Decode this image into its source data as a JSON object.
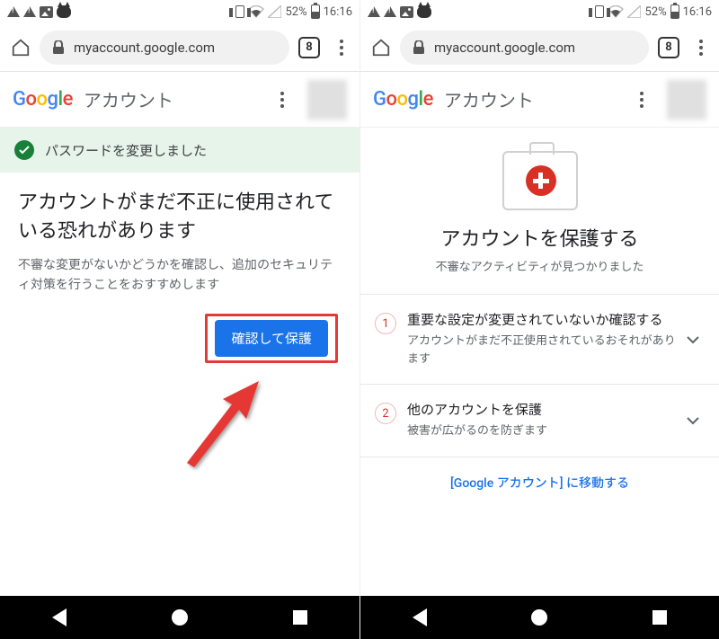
{
  "status": {
    "battery_pct": "52%",
    "clock": "16:16"
  },
  "urlbar": {
    "url": "myaccount.google.com",
    "tab_count": "8"
  },
  "header": {
    "logo_g1": "G",
    "logo_o1": "o",
    "logo_o2": "o",
    "logo_g2": "g",
    "logo_l": "l",
    "logo_e": "e",
    "title": "アカウント"
  },
  "left": {
    "banner": "パスワードを変更しました",
    "headline": "アカウントがまだ不正に使用されている恐れがあります",
    "sub": "不審な変更がないかどうかを確認し、追加のセキュリティ対策を行うことをおすすめします",
    "cta": "確認して保護"
  },
  "right": {
    "headline": "アカウントを保護する",
    "sub": "不審なアクティビティが見つかりました",
    "steps": [
      {
        "num": "1",
        "title": "重要な設定が変更されていないか確認する",
        "desc": "アカウントがまだ不正使用されているおそれがあります"
      },
      {
        "num": "2",
        "title": "他のアカウントを保護",
        "desc": "被害が広がるのを防ぎます"
      }
    ],
    "link": "[Google アカウント] に移動する"
  }
}
